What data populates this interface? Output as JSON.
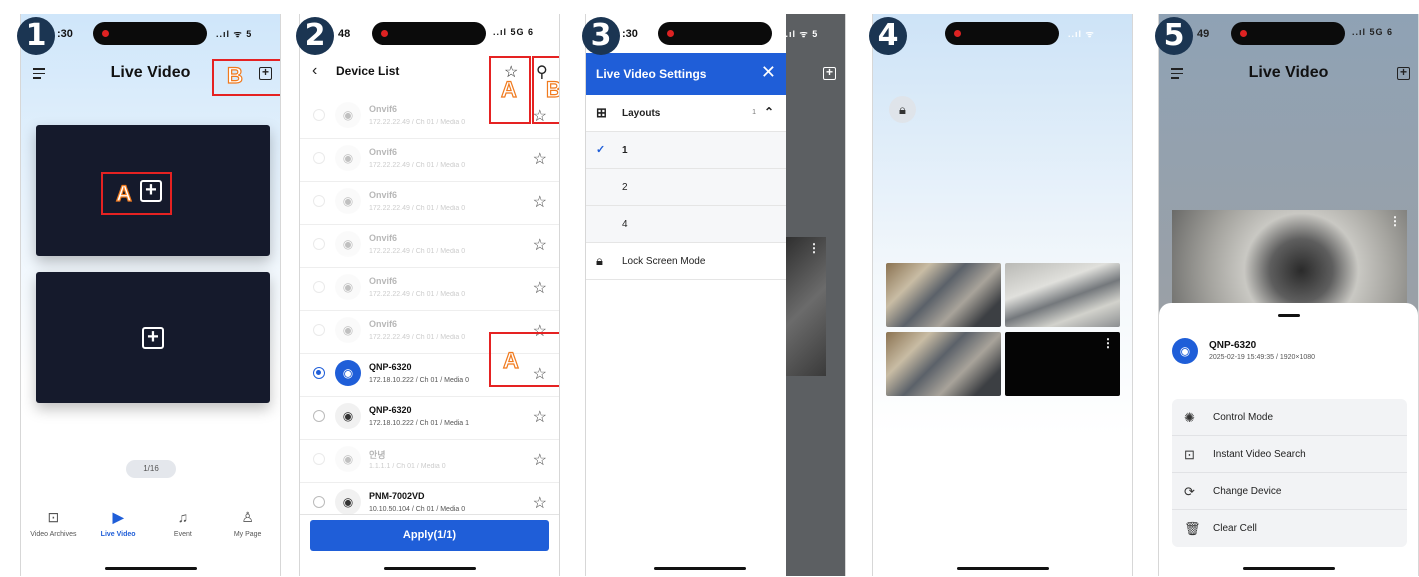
{
  "steps": [
    "1",
    "2",
    "3",
    "4",
    "5"
  ],
  "markers": {
    "a": "A",
    "b": "B"
  },
  "status": {
    "p1_time": ":30",
    "p2_time": "48",
    "p3_time": ":30",
    "p5_time": "49",
    "p1_icons": "..ıl ᯤ 5",
    "p2_icons": "..ıl 5G 6",
    "p3_icons": "..ıl ᯤ 5",
    "p4_icons": "..ıl ᯤ",
    "p5_icons": "..ıl 5G 6"
  },
  "screen1": {
    "title": "Live Video",
    "pager": "1/16",
    "tabs": [
      {
        "label": "Video Archives",
        "icon": "video-archives-icon"
      },
      {
        "label": "Live Video",
        "icon": "live-video-icon",
        "active": true
      },
      {
        "label": "Event",
        "icon": "bell-icon"
      },
      {
        "label": "My Page",
        "icon": "person-icon"
      }
    ]
  },
  "screen2": {
    "title": "Device List",
    "devices": [
      {
        "name": "Onvif6",
        "info": "172.22.22.49 / Ch 01 / Media 0",
        "dim": true
      },
      {
        "name": "Onvif6",
        "info": "172.22.22.49 / Ch 01 / Media 0",
        "dim": true
      },
      {
        "name": "Onvif6",
        "info": "172.22.22.49 / Ch 01 / Media 0",
        "dim": true
      },
      {
        "name": "Onvif6",
        "info": "172.22.22.49 / Ch 01 / Media 0",
        "dim": true
      },
      {
        "name": "Onvif6",
        "info": "172.22.22.49 / Ch 01 / Media 0",
        "dim": true
      },
      {
        "name": "Onvif6",
        "info": "172.22.22.49 / Ch 01 / Media 0",
        "dim": true
      },
      {
        "name": "QNP-6320",
        "info": "172.18.10.222 / Ch 01 / Media 0",
        "selected": true
      },
      {
        "name": "QNP-6320",
        "info": "172.18.10.222 / Ch 01 / Media 1"
      },
      {
        "name": "안녕",
        "info": "1.1.1.1 / Ch 01 / Media 0",
        "dim": true
      },
      {
        "name": "PNM-7002VD",
        "info": "10.10.50.104 / Ch 01 / Media 0"
      }
    ],
    "apply_label": "Apply(1/1)"
  },
  "screen3": {
    "title": "Live Video Settings",
    "layouts_label": "Layouts",
    "layouts_count": "1",
    "layout_options": [
      "1",
      "2",
      "4"
    ],
    "selected_layout": "1",
    "lock_label": "Lock Screen Mode"
  },
  "screen5": {
    "title": "Live Video",
    "device_name": "QNP-6320",
    "device_sub": "2025-02-19 15:49:35 / 1920×1080",
    "menu": [
      {
        "label": "Control Mode",
        "icon": "aperture-icon"
      },
      {
        "label": "Instant Video Search",
        "icon": "video-search-icon"
      },
      {
        "label": "Change Device",
        "icon": "refresh-icon"
      },
      {
        "label": "Clear Cell",
        "icon": "trash-icon"
      }
    ]
  }
}
